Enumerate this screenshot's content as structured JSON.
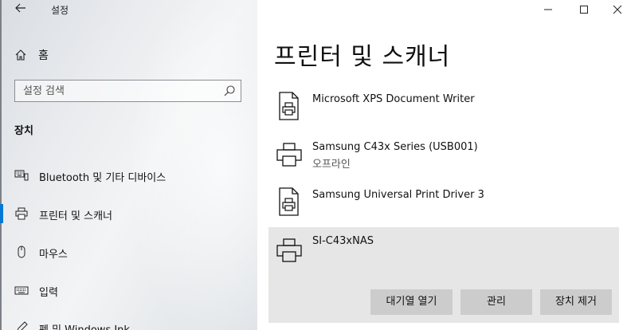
{
  "window": {
    "app_title": "설정",
    "back_icon": "back-arrow-icon",
    "controls": {
      "minimize": "—",
      "maximize": "☐",
      "close": "✕"
    }
  },
  "sidebar": {
    "home_label": "홈",
    "search_placeholder": "설정 검색",
    "section_heading": "장치",
    "items": [
      {
        "label": "Bluetooth 및 기타 디바이스",
        "icon": "bluetooth-devices-icon",
        "active": false
      },
      {
        "label": "프린터 및 스캐너",
        "icon": "printer-icon",
        "active": true
      },
      {
        "label": "마우스",
        "icon": "mouse-icon",
        "active": false
      },
      {
        "label": "입력",
        "icon": "keyboard-icon",
        "active": false
      },
      {
        "label": "펜 및 Windows Ink",
        "icon": "pen-icon",
        "active": false
      }
    ]
  },
  "main": {
    "title": "프린터 및 스캐너",
    "printers": [
      {
        "name": "Microsoft XPS Document Writer",
        "status": "",
        "icon": "printer-document-icon"
      },
      {
        "name": "Samsung C43x Series (USB001)",
        "status": "오프라인",
        "icon": "printer-icon"
      },
      {
        "name": "Samsung Universal Print Driver 3",
        "status": "",
        "icon": "printer-document-icon"
      },
      {
        "name": "SI-C43xNAS",
        "status": "",
        "icon": "printer-icon",
        "selected": true
      }
    ],
    "actions": {
      "open_queue": "대기열 열기",
      "manage": "관리",
      "remove_device": "장치 제거"
    }
  },
  "colors": {
    "accent": "#0078d7",
    "selected_bg": "#e6e6e6",
    "button_bg": "#cccccc"
  }
}
